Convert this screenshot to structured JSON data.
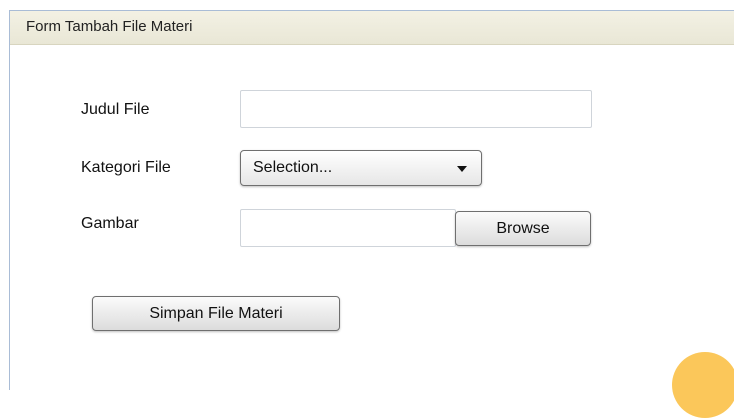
{
  "form": {
    "title": "Form Tambah File Materi",
    "judul_label": "Judul File",
    "judul_value": "",
    "kategori_label": "Kategori File",
    "kategori_selected": "Selection...",
    "gambar_label": "Gambar",
    "gambar_value": "",
    "browse_label": "Browse",
    "submit_label": "Simpan File Materi"
  },
  "colors": {
    "header_bg": "#efeddd",
    "panel_border": "#a9bcd6",
    "accent_blob": "#fbc75a"
  }
}
